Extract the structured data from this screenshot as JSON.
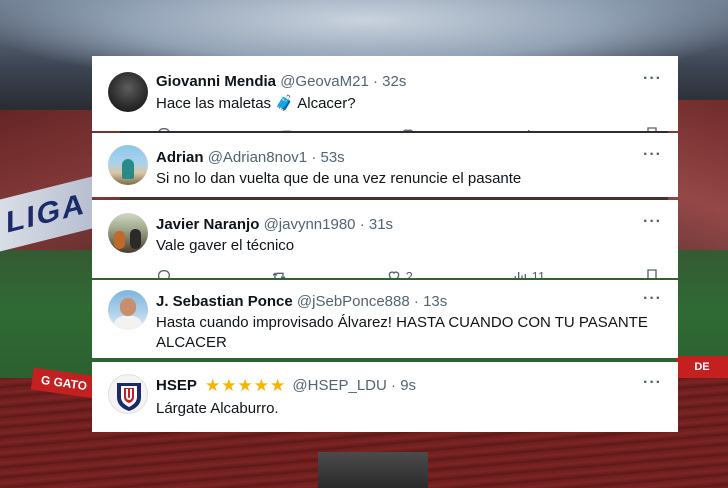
{
  "background": {
    "liga_banner": "LIGA",
    "gato_banner": "G GATO",
    "ad_right": "DE"
  },
  "replies": [
    {
      "name": "Giovanni Mendia",
      "handle": "@GeovaM21",
      "time": "32s",
      "text": "Hace las maletas 🧳 Alcacer?"
    },
    {
      "name": "Adrian",
      "handle": "@Adrian8nov1",
      "time": "53s",
      "text": "Si no lo dan vuelta que de una vez renuncie el pasante"
    },
    {
      "name": "Javier Naranjo",
      "handle": "@javynn1980",
      "time": "31s",
      "text": "Vale gaver el técnico",
      "likes": "2",
      "views": "11"
    },
    {
      "name": "J. Sebastian Ponce",
      "handle": "@jSebPonce888",
      "time": "13s",
      "text": "Hasta cuando improvisado Álvarez! HASTA CUANDO CON TU PASANTE ALCACER"
    },
    {
      "name": "HSEP",
      "stars": "★★★★★",
      "handle": "@HSEP_LDU",
      "time": "9s",
      "text": "Lárgate Alcaburro."
    }
  ],
  "separator": " · ",
  "more_icon": "···"
}
